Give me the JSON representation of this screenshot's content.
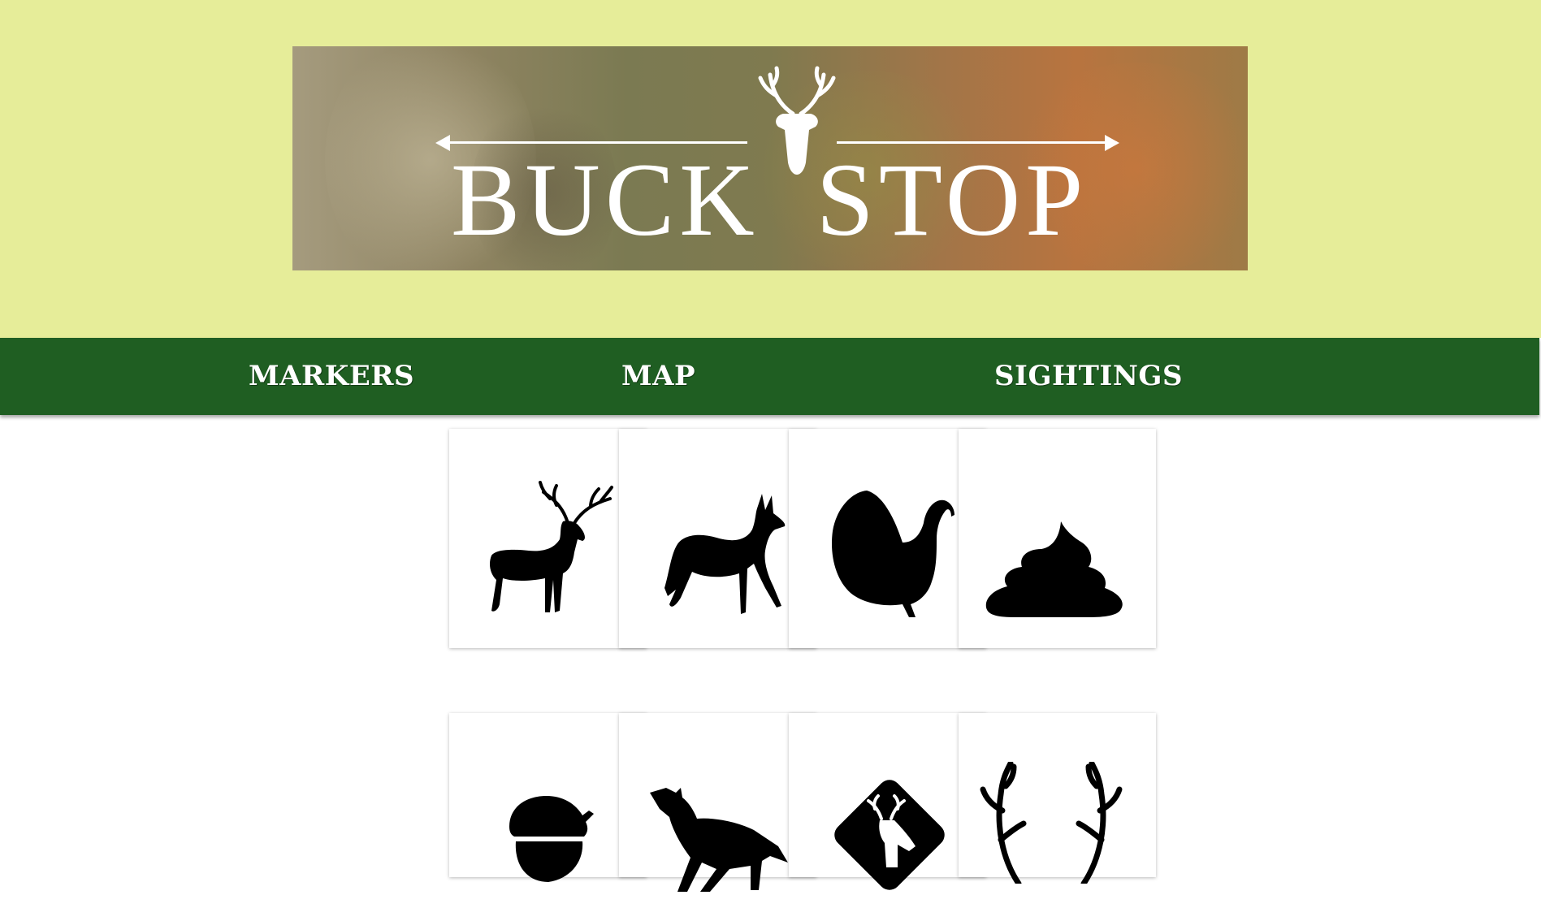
{
  "header": {
    "logo_text": [
      "BUCK",
      "STOP"
    ],
    "background_color": "#e6ed99"
  },
  "nav": {
    "background_color": "#1f5e22",
    "items": [
      {
        "label": "MARKERS"
      },
      {
        "label": "MAP"
      },
      {
        "label": "SIGHTINGS"
      }
    ]
  },
  "markers": {
    "rows": [
      [
        {
          "icon": "buck-icon"
        },
        {
          "icon": "doe-icon"
        },
        {
          "icon": "turkey-icon"
        },
        {
          "icon": "scat-icon"
        }
      ],
      [
        {
          "icon": "acorn-icon"
        },
        {
          "icon": "coyote-icon"
        },
        {
          "icon": "deer-crossing-icon"
        },
        {
          "icon": "antler-shed-icon"
        }
      ]
    ]
  }
}
